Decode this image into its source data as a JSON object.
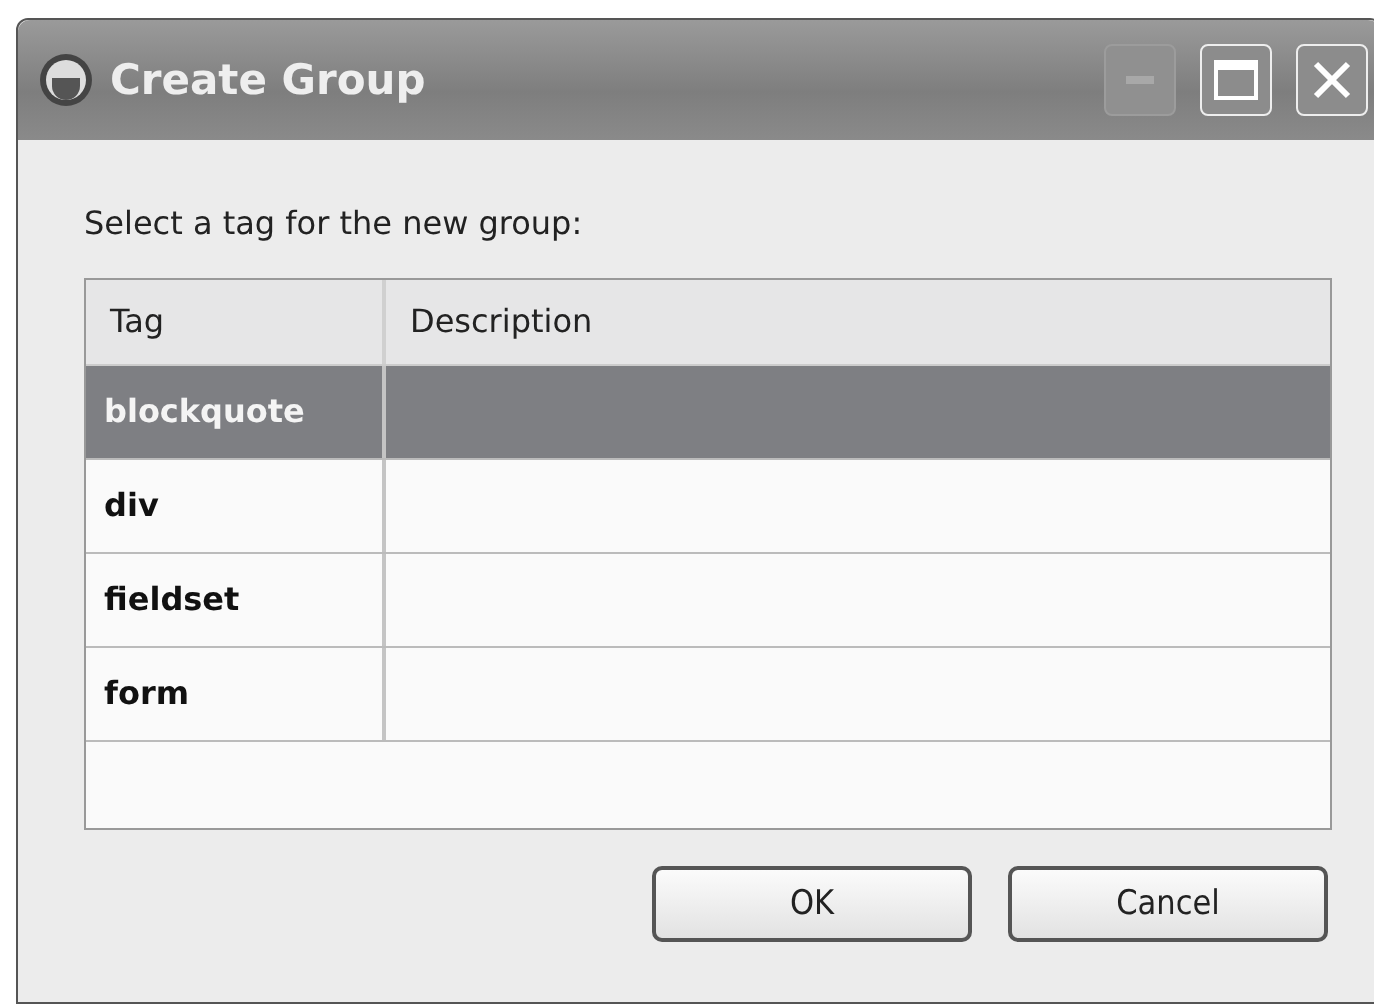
{
  "window": {
    "title": "Create Group",
    "controls": [
      {
        "kind": "minimize",
        "disabled": true
      },
      {
        "kind": "maximize",
        "disabled": false
      },
      {
        "kind": "close",
        "disabled": false
      }
    ]
  },
  "prompt": "Select a tag for the new group:",
  "table": {
    "columns": [
      "Tag",
      "Description"
    ],
    "rows": [
      {
        "tag": "blockquote",
        "selected": true
      },
      {
        "tag": "div",
        "selected": false
      },
      {
        "tag": "fieldset",
        "selected": false
      },
      {
        "tag": "form",
        "selected": false
      }
    ]
  },
  "buttons": [
    "OK",
    "Cancel"
  ]
}
